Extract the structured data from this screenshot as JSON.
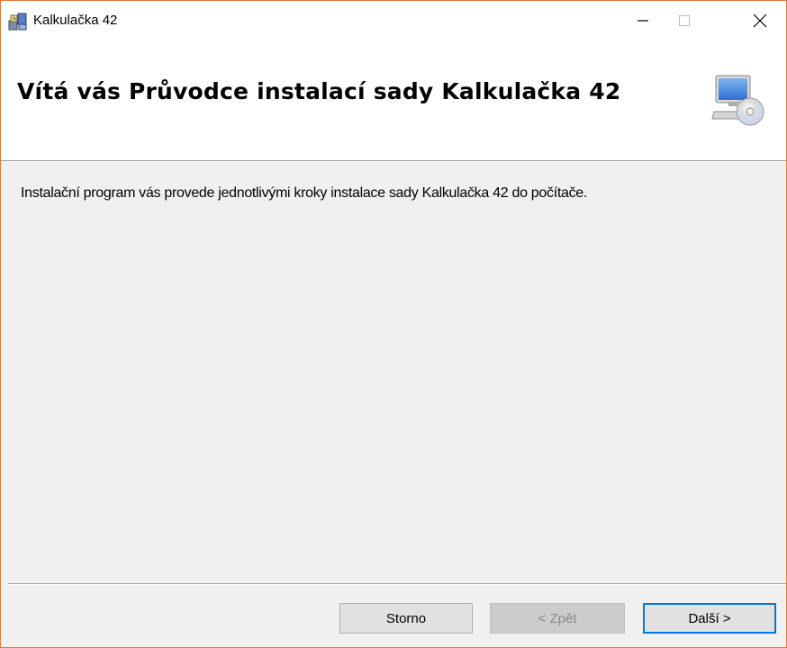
{
  "window": {
    "title": "Kalkulačka 42",
    "controls": {
      "minimize": "minimize-icon",
      "maximize": "maximize-icon",
      "close": "close-icon"
    }
  },
  "banner": {
    "title": "Vítá vás Průvodce instalací sady Kalkulačka 42",
    "icon": "computer-cd-icon"
  },
  "content": {
    "intro": "Instalační program vás provede jednotlivými kroky instalace sady Kalkulačka 42 do počítače."
  },
  "buttons": {
    "cancel": "Storno",
    "back": "< Zpět",
    "next": "Další >"
  },
  "colors": {
    "window_border": "#e07a3a",
    "focus_border": "#0078d7",
    "dialog_bg": "#f0f0f0"
  }
}
